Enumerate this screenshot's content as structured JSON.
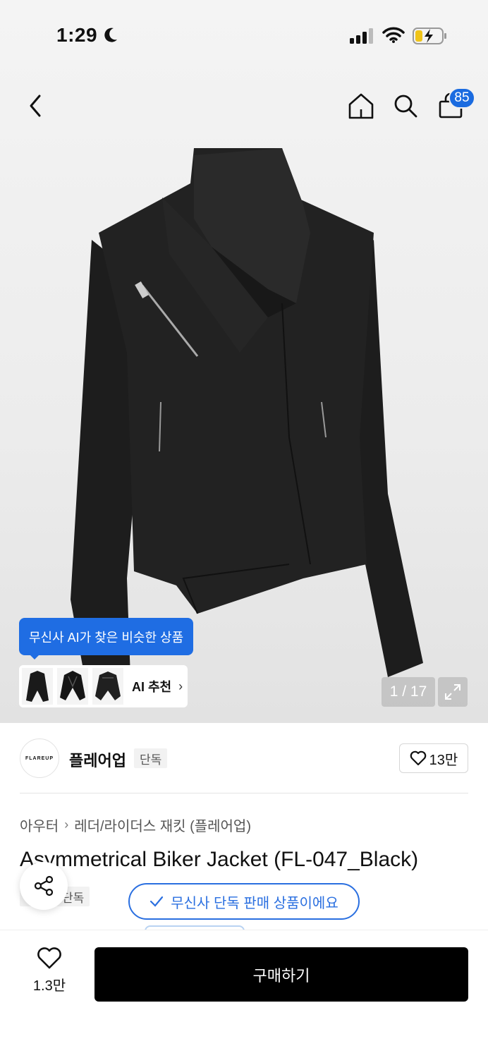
{
  "status_bar": {
    "time": "1:29",
    "icons": [
      "moon-icon",
      "signal-icon",
      "wifi-icon",
      "battery-charging-icon"
    ]
  },
  "nav": {
    "icons": [
      "back-icon",
      "home-icon",
      "search-icon",
      "cart-icon"
    ],
    "cart_count": "85"
  },
  "gallery": {
    "counter": "1 / 17",
    "icons": [
      "expand-icon"
    ]
  },
  "ai": {
    "tooltip": "무신사 AI가 찾은 비슷한 상품",
    "label": "AI 추천",
    "chevron": "›"
  },
  "brand": {
    "logo_text": "FLAREUP",
    "name": "플레어업",
    "tag": "단독",
    "like_count": "13만"
  },
  "product": {
    "breadcrumb": [
      "아우터",
      "레더/라이더스 재킷 (플레어업)"
    ],
    "breadcrumb_sep": "›",
    "title": "Asymmetrical Biker Jacket (FL-047_Black)",
    "tag": "단독",
    "exclusive_notice": "무신사 단독 판매 상품이에요"
  },
  "bottom_bar": {
    "like_count": "1.3만",
    "buy_label": "구매하기"
  },
  "colors": {
    "accent": "#1f6de3",
    "buy_button": "#000000",
    "jacket": "#1c1c1c"
  }
}
